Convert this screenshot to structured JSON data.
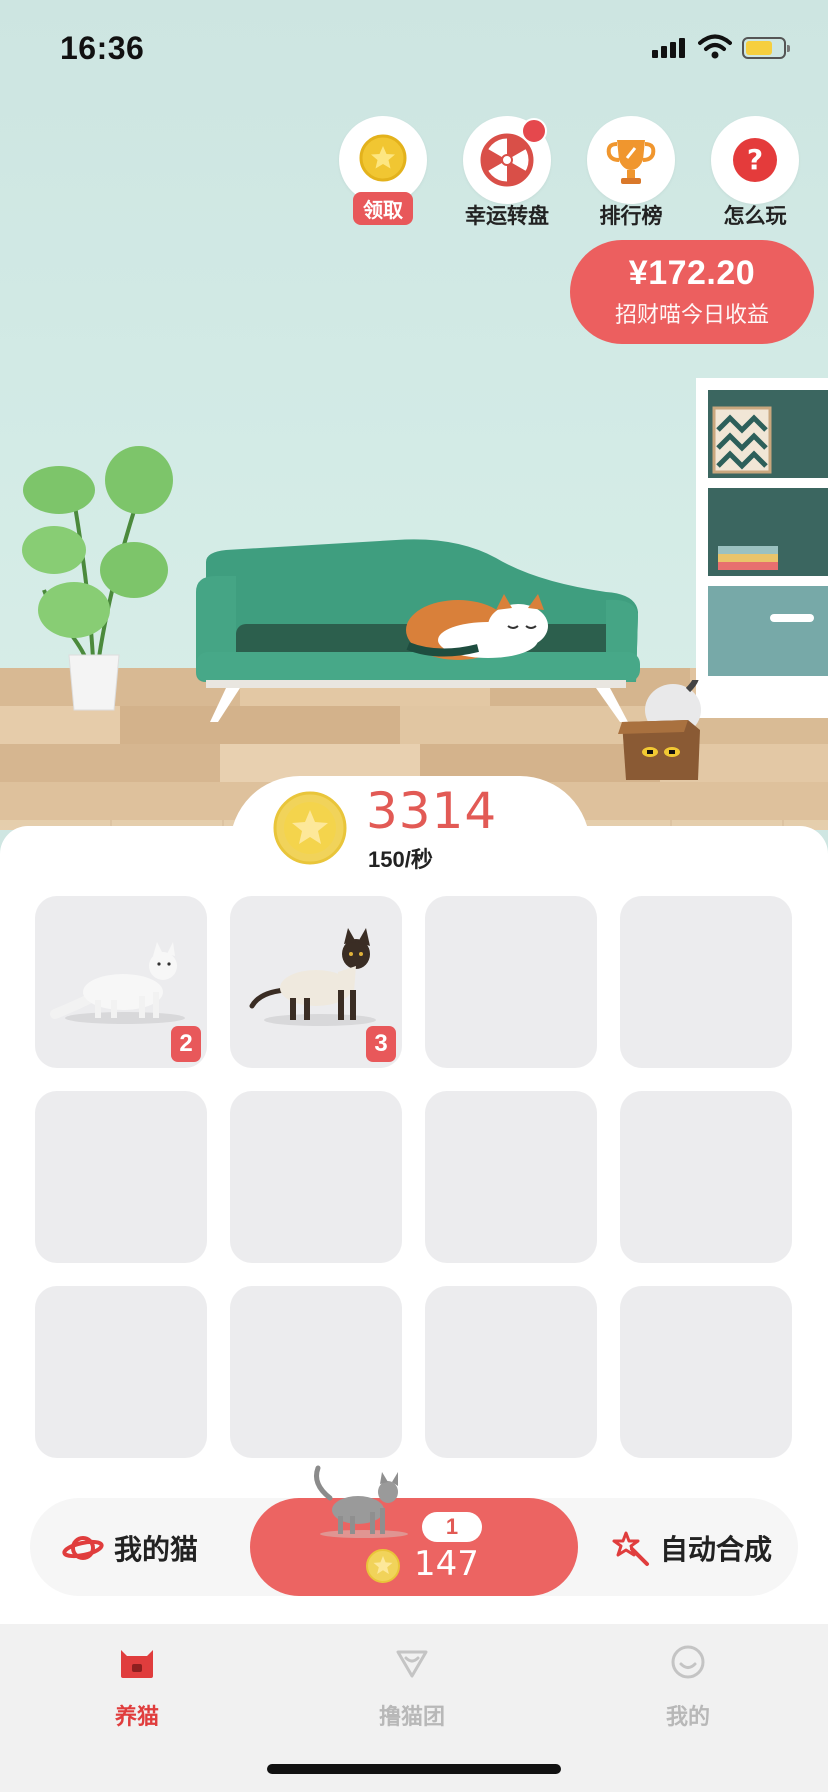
{
  "status": {
    "time": "16:36"
  },
  "features": [
    {
      "label": "领取",
      "icon": "coin-star-icon"
    },
    {
      "label": "幸运转盘",
      "icon": "wheel-icon"
    },
    {
      "label": "排行榜",
      "icon": "trophy-icon"
    },
    {
      "label": "怎么玩",
      "icon": "question-icon"
    }
  ],
  "earnings": {
    "amount": "¥172.20",
    "label": "招财喵今日收益"
  },
  "coins": {
    "count": "3314",
    "rate": "150/秒"
  },
  "grid": {
    "cells": [
      {
        "level": "2",
        "cat": "white-cat"
      },
      {
        "level": "3",
        "cat": "siamese-cat"
      },
      {},
      {},
      {},
      {},
      {},
      {},
      {},
      {},
      {},
      {}
    ]
  },
  "actions": {
    "my_cats": "我的猫",
    "buy_level": "1",
    "buy_price": "147",
    "auto_merge": "自动合成"
  },
  "tabs": [
    {
      "label": "养猫",
      "active": true
    },
    {
      "label": "撸猫团",
      "active": false
    },
    {
      "label": "我的",
      "active": false
    }
  ],
  "colors": {
    "accent": "#ec6462",
    "sofa": "#3f9e7f",
    "inactive": "#b8b8b8"
  }
}
